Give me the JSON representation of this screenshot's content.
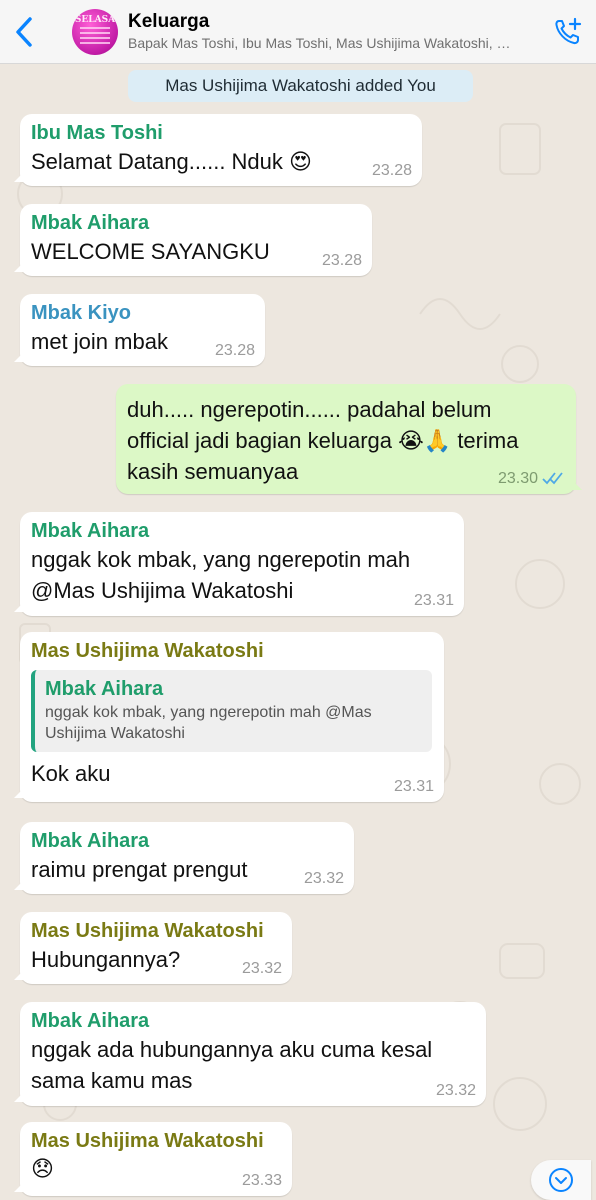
{
  "header": {
    "title": "Keluarga",
    "subtitle": "Bapak Mas Toshi, Ibu Mas Toshi, Mas Ushijima Wakatoshi, …",
    "avatar_text": "SELASA",
    "back_icon": "chevron-left-icon",
    "call_icon": "add-call-icon"
  },
  "colors": {
    "accent": "#0a84ff",
    "green_name": "#1f9d6b",
    "blue_name": "#3a93c0",
    "olive_name": "#7a7a14",
    "outgoing_bubble": "#dcf8c6",
    "incoming_bubble": "#ffffff"
  },
  "system_message": "Mas Ushijima Wakatoshi added You",
  "messages": [
    {
      "sender": "Ibu Mas Toshi",
      "text": "Selamat Datang...... Nduk 😍",
      "time": "23.28"
    },
    {
      "sender": "Mbak Aihara",
      "text": "WELCOME SAYANGKU",
      "time": "23.28"
    },
    {
      "sender": "Mbak Kiyo",
      "text": "met join mbak",
      "time": "23.28"
    },
    {
      "sender": "",
      "text_line1": "duh..... ngerepotin...... padahal belum",
      "text_line2": "official jadi bagian keluarga 😭🙏 terima",
      "text_line3": "kasih semuanyaa",
      "time": "23.30",
      "status": "read"
    },
    {
      "sender": "Mbak Aihara",
      "text_line1": "nggak kok mbak, yang ngerepotin mah",
      "text_line2": "@Mas Ushijima Wakatoshi",
      "time": "23.31"
    },
    {
      "sender": "Mas Ushijima Wakatoshi",
      "quote_sender": "Mbak Aihara",
      "quote_line1": "nggak kok mbak, yang ngerepotin mah @Mas",
      "quote_line2": "Ushijima Wakatoshi",
      "text": "Kok aku",
      "time": "23.31"
    },
    {
      "sender": "Mbak Aihara",
      "text": "raimu prengat prengut",
      "time": "23.32"
    },
    {
      "sender": "Mas Ushijima Wakatoshi",
      "text": "Hubungannya?",
      "time": "23.32"
    },
    {
      "sender": "Mbak Aihara",
      "text_line1": "nggak ada hubungannya aku cuma kesal",
      "text_line2": "sama kamu mas",
      "time": "23.32"
    },
    {
      "sender": "Mas Ushijima Wakatoshi",
      "text": "😞",
      "time": "23.33"
    }
  ],
  "scroll_down_icon": "chevron-down-circle-icon"
}
